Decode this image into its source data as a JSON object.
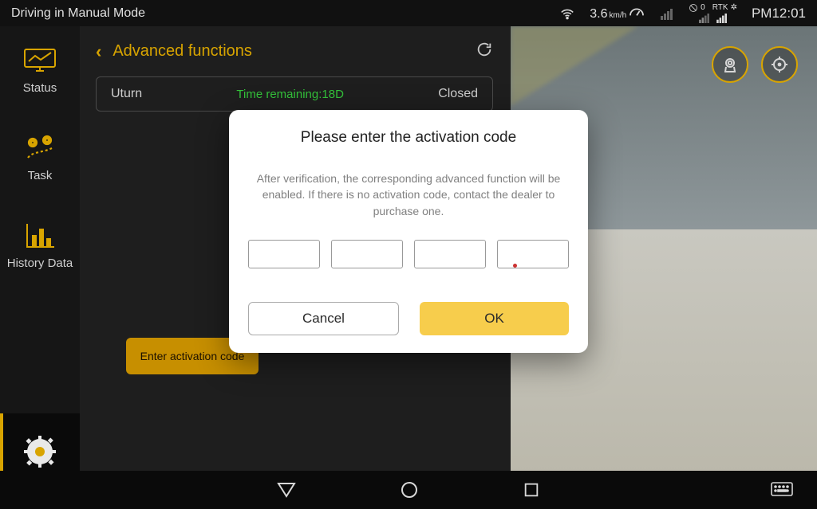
{
  "statusbar": {
    "mode_text": "Driving in Manual Mode",
    "speed_value": "3.6",
    "speed_unit": "km/h",
    "rtk_label": "RTK",
    "rtk_count": "0",
    "time": "PM12:01"
  },
  "sidebar": {
    "items": [
      {
        "label": "Status",
        "icon": "monitor-chart-icon"
      },
      {
        "label": "Task",
        "icon": "route-pin-icon"
      },
      {
        "label": "History Data",
        "icon": "bar-chart-icon"
      },
      {
        "label": "Settings",
        "icon": "gear-icon"
      }
    ]
  },
  "panel": {
    "title": "Advanced functions",
    "row": {
      "name": "Uturn",
      "time_text": "Time remaining:18D",
      "status": "Closed"
    },
    "enter_code_button": "Enter activation code"
  },
  "camera_view": {
    "camera_button_icon": "camera-icon",
    "target_button_icon": "crosshair-icon"
  },
  "dialog": {
    "title": "Please enter the activation code",
    "description": "After verification, the corresponding advanced function will be enabled. If there is no activation code, contact the dealer to purchase one.",
    "segments": [
      "",
      "",
      "",
      ""
    ],
    "cancel_label": "Cancel",
    "ok_label": "OK"
  },
  "navbar": {
    "back_icon": "triangle-back-icon",
    "home_icon": "circle-home-icon",
    "recent_icon": "square-recent-icon",
    "keyboard_icon": "keyboard-icon"
  },
  "colors": {
    "accent": "#d8a400",
    "ok_button": "#f7cd4c",
    "time_green": "#33c23a"
  }
}
